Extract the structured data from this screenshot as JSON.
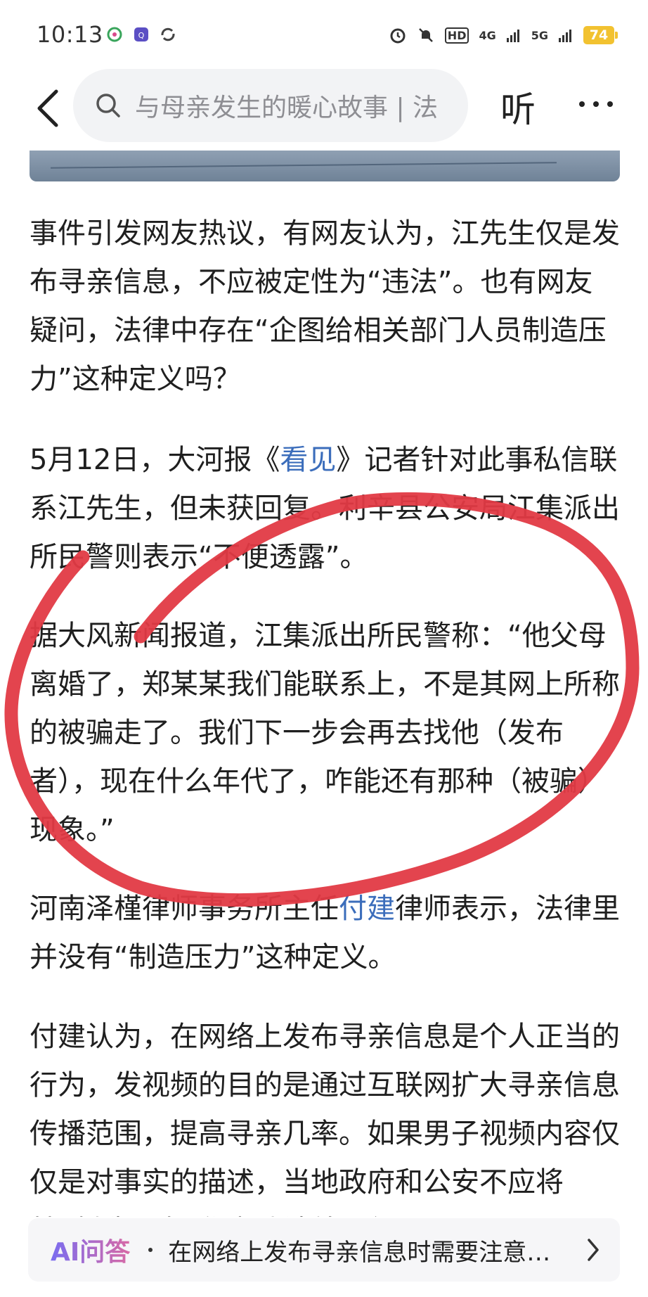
{
  "status_bar": {
    "time": "10:13",
    "network_4g": "4G",
    "network_5g": "5G",
    "hd_label": "HD",
    "battery": "74"
  },
  "nav": {
    "search_text": "与母亲发生的暖心故事 | 法",
    "listen_label": "听"
  },
  "article": {
    "p1": "事件引发网友热议，有网友认为，江先生仅是发布寻亲信息，不应被定性为“违法”。也有网友疑问，法律中存在“企图给相关部门人员制造压力”这种定义吗？",
    "p2_before": "5月12日，大河报《",
    "p2_link": "看见",
    "p2_after": "》记者针对此事私信联系江先生，但未获回复。利辛县公安局江集派出所民警则表示“不便透露”。",
    "p3": "据大风新闻报道，江集派出所民警称：“他父母离婚了，郑某某我们能联系上，不是其网上所称的被骗走了。我们下一步会再去找他（发布者），现在什么年代了，咋能还有那种（被骗）现象。”",
    "p4_before": "河南泽槿律师事务所主任",
    "p4_link": "付建",
    "p4_after": "律师表示，法律里并没有“制造压力”这种定义。",
    "p5": "付建认为，在网络上发布寻亲信息是个人正当的行为，发视频的目的是通过互联网扩大寻亲信息传播范围，提高寻亲几率。如果男子视频内容仅仅是对事实的描述，当地政府和公安不应将其“制造压力”作为违法处罚行"
  },
  "ai_bar": {
    "label": "AI问答",
    "question": "在网络上发布寻亲信息时需要注意…"
  },
  "colors": {
    "link": "#3b6dbb",
    "annotation": "#e23a44",
    "battery": "#f2c230"
  }
}
